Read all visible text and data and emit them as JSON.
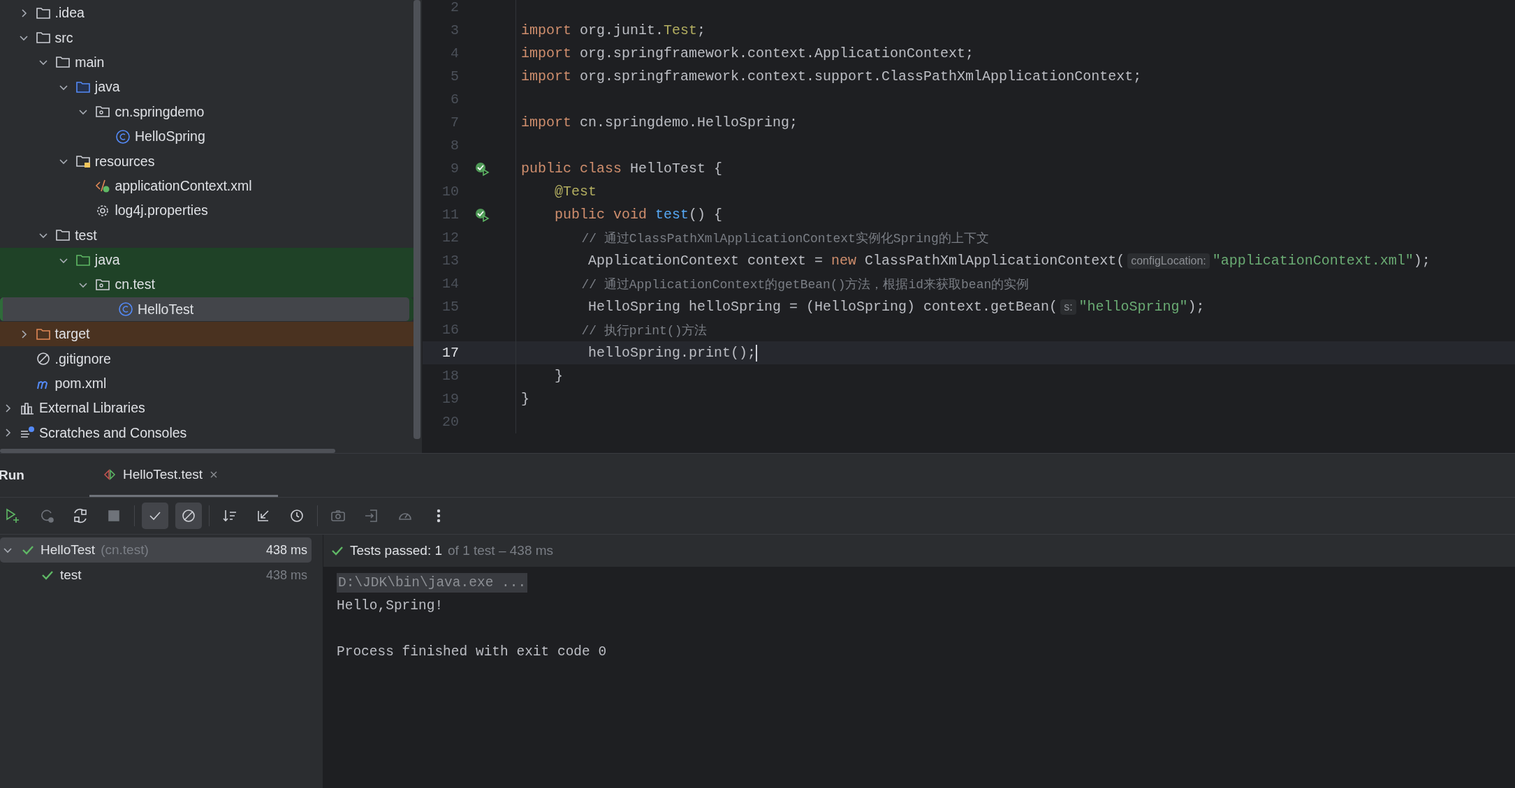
{
  "project_tree": {
    "items": [
      {
        "label": ".idea",
        "kind": "folder",
        "expanded": false,
        "selected": false,
        "test_scope": false,
        "excluded": false
      },
      {
        "label": "src",
        "kind": "folder",
        "expanded": true,
        "selected": false,
        "test_scope": false,
        "excluded": false,
        "children": [
          {
            "label": "main",
            "kind": "folder",
            "expanded": true,
            "selected": false,
            "test_scope": false,
            "excluded": false,
            "children": [
              {
                "label": "java",
                "kind": "source-folder",
                "expanded": true,
                "selected": false,
                "test_scope": false,
                "excluded": false,
                "children": [
                  {
                    "label": "cn.springdemo",
                    "kind": "package",
                    "expanded": true,
                    "selected": false,
                    "test_scope": false,
                    "excluded": false,
                    "children": [
                      {
                        "label": "HelloSpring",
                        "kind": "class",
                        "selected": false,
                        "test_scope": false,
                        "excluded": false
                      }
                    ]
                  }
                ]
              },
              {
                "label": "resources",
                "kind": "resources-folder",
                "expanded": true,
                "selected": false,
                "test_scope": false,
                "excluded": false,
                "children": [
                  {
                    "label": "applicationContext.xml",
                    "kind": "xml",
                    "selected": false,
                    "test_scope": false,
                    "excluded": false
                  },
                  {
                    "label": "log4j.properties",
                    "kind": "settings",
                    "selected": false,
                    "test_scope": false,
                    "excluded": false
                  }
                ]
              }
            ]
          },
          {
            "label": "test",
            "kind": "folder",
            "expanded": true,
            "selected": false,
            "test_scope": false,
            "excluded": false,
            "children": [
              {
                "label": "java",
                "kind": "test-folder",
                "expanded": true,
                "selected": false,
                "test_scope": true,
                "excluded": false,
                "children": [
                  {
                    "label": "cn.test",
                    "kind": "package",
                    "expanded": true,
                    "selected": false,
                    "test_scope": true,
                    "excluded": false,
                    "children": [
                      {
                        "label": "HelloTest",
                        "kind": "class",
                        "selected": true,
                        "test_scope": true,
                        "excluded": false
                      }
                    ]
                  }
                ]
              }
            ]
          }
        ]
      },
      {
        "label": "target",
        "kind": "excluded-folder",
        "expanded": false,
        "selected": false,
        "test_scope": false,
        "excluded": true
      },
      {
        "label": ".gitignore",
        "kind": "ignore",
        "selected": false,
        "test_scope": false,
        "excluded": false
      },
      {
        "label": "pom.xml",
        "kind": "maven",
        "selected": false,
        "test_scope": false,
        "excluded": false
      }
    ],
    "libraries": [
      {
        "label": "External Libraries",
        "kind": "libraries",
        "expanded": false,
        "selected": false,
        "test_scope": false,
        "excluded": false
      },
      {
        "label": "Scratches and Consoles",
        "kind": "scratches",
        "expanded": false,
        "selected": false,
        "test_scope": false,
        "excluded": false
      }
    ]
  },
  "editor": {
    "lines": [
      {
        "number": "2",
        "current": false,
        "passed_marker": false
      },
      {
        "number": "3",
        "current": false,
        "passed_marker": false,
        "tokens": [
          {
            "text": "import ",
            "kind": "keyword"
          },
          {
            "text": "org.junit.",
            "kind": "plain"
          },
          {
            "text": "Test",
            "kind": "annotation"
          },
          {
            "text": ";",
            "kind": "plain"
          }
        ]
      },
      {
        "number": "4",
        "current": false,
        "passed_marker": false,
        "tokens": [
          {
            "text": "import ",
            "kind": "keyword"
          },
          {
            "text": "org.springframework.context.ApplicationContext;",
            "kind": "plain"
          }
        ]
      },
      {
        "number": "5",
        "current": false,
        "passed_marker": false,
        "tokens": [
          {
            "text": "import ",
            "kind": "keyword"
          },
          {
            "text": "org.springframework.context.support.ClassPathXmlApplicationContext;",
            "kind": "plain"
          }
        ]
      },
      {
        "number": "6",
        "current": false,
        "passed_marker": false
      },
      {
        "number": "7",
        "current": false,
        "passed_marker": false,
        "tokens": [
          {
            "text": "import ",
            "kind": "keyword"
          },
          {
            "text": "cn.springdemo.HelloSpring;",
            "kind": "plain"
          }
        ]
      },
      {
        "number": "8",
        "current": false,
        "passed_marker": false
      },
      {
        "number": "9",
        "current": false,
        "passed_marker": true,
        "tokens": [
          {
            "text": "public class ",
            "kind": "keyword"
          },
          {
            "text": "HelloTest {",
            "kind": "plain"
          }
        ]
      },
      {
        "number": "10",
        "current": false,
        "passed_marker": false,
        "tokens": [
          {
            "text": "    @Test",
            "kind": "annotation"
          }
        ]
      },
      {
        "number": "11",
        "current": false,
        "passed_marker": true,
        "tokens": [
          {
            "text": "    public void ",
            "kind": "keyword"
          },
          {
            "text": "test",
            "kind": "function"
          },
          {
            "text": "() {",
            "kind": "plain"
          }
        ]
      },
      {
        "number": "12",
        "current": false,
        "passed_marker": false,
        "tokens": [
          {
            "text": "        // 通过ClassPathXmlApplicationContext实例化Spring的上下文",
            "kind": "comment"
          }
        ]
      },
      {
        "number": "13",
        "current": false,
        "passed_marker": false,
        "tokens": [
          {
            "text": "        ApplicationContext context = ",
            "kind": "plain"
          },
          {
            "text": "new ",
            "kind": "keyword"
          },
          {
            "text": "ClassPathXmlApplicationContext(",
            "kind": "plain"
          },
          {
            "text": "configLocation:",
            "kind": "hint"
          },
          {
            "text": "\"applicationContext.xml\"",
            "kind": "string"
          },
          {
            "text": ");",
            "kind": "plain"
          }
        ]
      },
      {
        "number": "14",
        "current": false,
        "passed_marker": false,
        "tokens": [
          {
            "text": "        // 通过ApplicationContext的getBean()方法，根据id来获取bean的实例",
            "kind": "comment"
          }
        ]
      },
      {
        "number": "15",
        "current": false,
        "passed_marker": false,
        "tokens": [
          {
            "text": "        HelloSpring helloSpring = (HelloSpring) context.getBean(",
            "kind": "plain"
          },
          {
            "text": "s:",
            "kind": "hint"
          },
          {
            "text": "\"helloSpring\"",
            "kind": "string"
          },
          {
            "text": ");",
            "kind": "plain"
          }
        ]
      },
      {
        "number": "16",
        "current": false,
        "passed_marker": false,
        "tokens": [
          {
            "text": "        // 执行print()方法",
            "kind": "comment"
          }
        ]
      },
      {
        "number": "17",
        "current": true,
        "passed_marker": false,
        "tokens": [
          {
            "text": "        helloSpring.print();",
            "kind": "plain"
          }
        ]
      },
      {
        "number": "18",
        "current": false,
        "passed_marker": false,
        "tokens": [
          {
            "text": "    }",
            "kind": "plain"
          }
        ]
      },
      {
        "number": "19",
        "current": false,
        "passed_marker": false,
        "tokens": [
          {
            "text": "}",
            "kind": "plain"
          }
        ]
      },
      {
        "number": "20",
        "current": false,
        "passed_marker": false
      }
    ]
  },
  "run_panel": {
    "title": "Run",
    "tabs": [
      {
        "label": "HelloTest.test",
        "selected": true
      }
    ],
    "toolbar": [
      {
        "kind": "rerun",
        "toggled": false,
        "disabled": false
      },
      {
        "kind": "rerun-failed",
        "toggled": false,
        "disabled": true
      },
      {
        "kind": "auto-test",
        "toggled": false,
        "disabled": false
      },
      {
        "kind": "stop",
        "toggled": false,
        "disabled": true
      },
      {
        "kind": "show-passed",
        "toggled": true,
        "disabled": false
      },
      {
        "kind": "show-ignored",
        "toggled": true,
        "disabled": false
      },
      {
        "kind": "sort",
        "toggled": false,
        "disabled": false
      },
      {
        "kind": "import",
        "toggled": false,
        "disabled": false
      },
      {
        "kind": "history",
        "toggled": false,
        "disabled": false
      },
      {
        "kind": "screenshot",
        "toggled": false,
        "disabled": true
      },
      {
        "kind": "export",
        "toggled": false,
        "disabled": true
      },
      {
        "kind": "coverage",
        "toggled": false,
        "disabled": true
      },
      {
        "kind": "more",
        "toggled": false,
        "disabled": false
      }
    ],
    "tests": [
      {
        "name": "HelloTest",
        "package": "(cn.test)",
        "time": "438 ms",
        "expanded": true,
        "selected": true,
        "children": [
          {
            "name": "test",
            "time": "438 ms",
            "selected": false
          }
        ]
      }
    ],
    "status": {
      "passed": "Tests passed: 1",
      "detail": "of 1 test – 438 ms"
    },
    "console": [
      {
        "text": "D:\\JDK\\bin\\java.exe ...",
        "kind": "command"
      },
      {
        "text": "Hello,Spring!",
        "kind": "output"
      },
      {
        "text": "Process finished with exit code 0",
        "kind": "exit"
      }
    ]
  }
}
